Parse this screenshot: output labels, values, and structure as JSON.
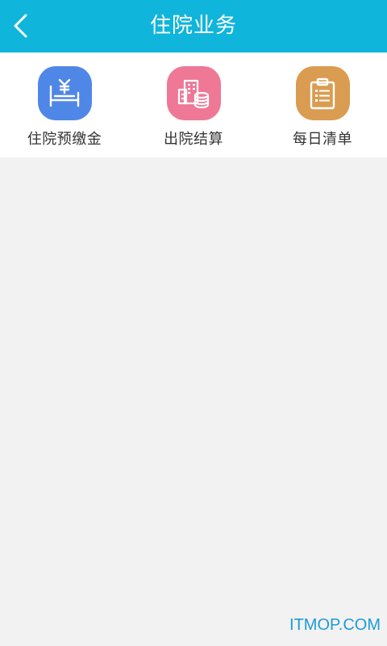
{
  "header": {
    "title": "住院业务",
    "background": "#0fb5db"
  },
  "menu": [
    {
      "label": "住院预缴金",
      "icon": "bed-yen-icon",
      "color": "#4f87e6"
    },
    {
      "label": "出院结算",
      "icon": "building-coins-icon",
      "color": "#ee7896"
    },
    {
      "label": "每日清单",
      "icon": "clipboard-list-icon",
      "color": "#d99c50"
    }
  ],
  "watermark": "ITMOP.COM"
}
